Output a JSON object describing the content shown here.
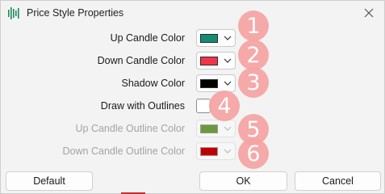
{
  "window": {
    "title": "Price Style Properties",
    "app_icon": "bar-chart-icon",
    "close_icon": "close-icon"
  },
  "rows": [
    {
      "label": "Up Candle Color",
      "color": "#138c73",
      "enabled": true,
      "badge": "1"
    },
    {
      "label": "Down Candle Color",
      "color": "#f2344b",
      "enabled": true,
      "badge": "2"
    },
    {
      "label": "Shadow Color",
      "color": "#000000",
      "enabled": true,
      "badge": "3"
    },
    {
      "label": "Up Candle Outline Color",
      "color": "#6a9a3a",
      "enabled": false,
      "badge": "5"
    },
    {
      "label": "Down Candle Outline Color",
      "color": "#c00000",
      "enabled": false,
      "badge": "6"
    }
  ],
  "outline_toggle": {
    "label": "Draw with Outlines",
    "checked": false,
    "badge": "4"
  },
  "buttons": {
    "default": "Default",
    "ok": "OK",
    "cancel": "Cancel"
  },
  "colors": {
    "badge": "#f6a3a3",
    "accent": "#c62d2d"
  }
}
